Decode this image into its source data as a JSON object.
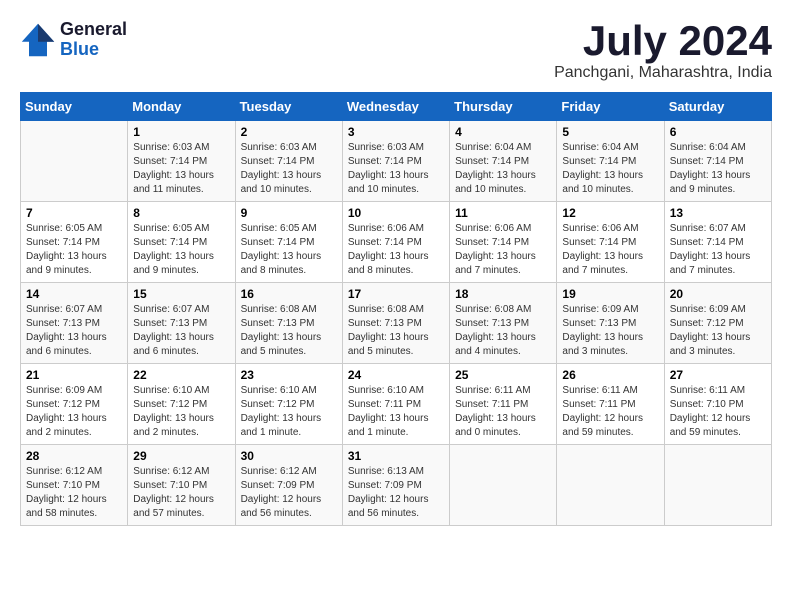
{
  "header": {
    "logo_line1": "General",
    "logo_line2": "Blue",
    "month": "July 2024",
    "location": "Panchgani, Maharashtra, India"
  },
  "columns": [
    "Sunday",
    "Monday",
    "Tuesday",
    "Wednesday",
    "Thursday",
    "Friday",
    "Saturday"
  ],
  "weeks": [
    [
      {
        "day": "",
        "info": ""
      },
      {
        "day": "1",
        "info": "Sunrise: 6:03 AM\nSunset: 7:14 PM\nDaylight: 13 hours\nand 11 minutes."
      },
      {
        "day": "2",
        "info": "Sunrise: 6:03 AM\nSunset: 7:14 PM\nDaylight: 13 hours\nand 10 minutes."
      },
      {
        "day": "3",
        "info": "Sunrise: 6:03 AM\nSunset: 7:14 PM\nDaylight: 13 hours\nand 10 minutes."
      },
      {
        "day": "4",
        "info": "Sunrise: 6:04 AM\nSunset: 7:14 PM\nDaylight: 13 hours\nand 10 minutes."
      },
      {
        "day": "5",
        "info": "Sunrise: 6:04 AM\nSunset: 7:14 PM\nDaylight: 13 hours\nand 10 minutes."
      },
      {
        "day": "6",
        "info": "Sunrise: 6:04 AM\nSunset: 7:14 PM\nDaylight: 13 hours\nand 9 minutes."
      }
    ],
    [
      {
        "day": "7",
        "info": "Sunrise: 6:05 AM\nSunset: 7:14 PM\nDaylight: 13 hours\nand 9 minutes."
      },
      {
        "day": "8",
        "info": "Sunrise: 6:05 AM\nSunset: 7:14 PM\nDaylight: 13 hours\nand 9 minutes."
      },
      {
        "day": "9",
        "info": "Sunrise: 6:05 AM\nSunset: 7:14 PM\nDaylight: 13 hours\nand 8 minutes."
      },
      {
        "day": "10",
        "info": "Sunrise: 6:06 AM\nSunset: 7:14 PM\nDaylight: 13 hours\nand 8 minutes."
      },
      {
        "day": "11",
        "info": "Sunrise: 6:06 AM\nSunset: 7:14 PM\nDaylight: 13 hours\nand 7 minutes."
      },
      {
        "day": "12",
        "info": "Sunrise: 6:06 AM\nSunset: 7:14 PM\nDaylight: 13 hours\nand 7 minutes."
      },
      {
        "day": "13",
        "info": "Sunrise: 6:07 AM\nSunset: 7:14 PM\nDaylight: 13 hours\nand 7 minutes."
      }
    ],
    [
      {
        "day": "14",
        "info": "Sunrise: 6:07 AM\nSunset: 7:13 PM\nDaylight: 13 hours\nand 6 minutes."
      },
      {
        "day": "15",
        "info": "Sunrise: 6:07 AM\nSunset: 7:13 PM\nDaylight: 13 hours\nand 6 minutes."
      },
      {
        "day": "16",
        "info": "Sunrise: 6:08 AM\nSunset: 7:13 PM\nDaylight: 13 hours\nand 5 minutes."
      },
      {
        "day": "17",
        "info": "Sunrise: 6:08 AM\nSunset: 7:13 PM\nDaylight: 13 hours\nand 5 minutes."
      },
      {
        "day": "18",
        "info": "Sunrise: 6:08 AM\nSunset: 7:13 PM\nDaylight: 13 hours\nand 4 minutes."
      },
      {
        "day": "19",
        "info": "Sunrise: 6:09 AM\nSunset: 7:13 PM\nDaylight: 13 hours\nand 3 minutes."
      },
      {
        "day": "20",
        "info": "Sunrise: 6:09 AM\nSunset: 7:12 PM\nDaylight: 13 hours\nand 3 minutes."
      }
    ],
    [
      {
        "day": "21",
        "info": "Sunrise: 6:09 AM\nSunset: 7:12 PM\nDaylight: 13 hours\nand 2 minutes."
      },
      {
        "day": "22",
        "info": "Sunrise: 6:10 AM\nSunset: 7:12 PM\nDaylight: 13 hours\nand 2 minutes."
      },
      {
        "day": "23",
        "info": "Sunrise: 6:10 AM\nSunset: 7:12 PM\nDaylight: 13 hours\nand 1 minute."
      },
      {
        "day": "24",
        "info": "Sunrise: 6:10 AM\nSunset: 7:11 PM\nDaylight: 13 hours\nand 1 minute."
      },
      {
        "day": "25",
        "info": "Sunrise: 6:11 AM\nSunset: 7:11 PM\nDaylight: 13 hours\nand 0 minutes."
      },
      {
        "day": "26",
        "info": "Sunrise: 6:11 AM\nSunset: 7:11 PM\nDaylight: 12 hours\nand 59 minutes."
      },
      {
        "day": "27",
        "info": "Sunrise: 6:11 AM\nSunset: 7:10 PM\nDaylight: 12 hours\nand 59 minutes."
      }
    ],
    [
      {
        "day": "28",
        "info": "Sunrise: 6:12 AM\nSunset: 7:10 PM\nDaylight: 12 hours\nand 58 minutes."
      },
      {
        "day": "29",
        "info": "Sunrise: 6:12 AM\nSunset: 7:10 PM\nDaylight: 12 hours\nand 57 minutes."
      },
      {
        "day": "30",
        "info": "Sunrise: 6:12 AM\nSunset: 7:09 PM\nDaylight: 12 hours\nand 56 minutes."
      },
      {
        "day": "31",
        "info": "Sunrise: 6:13 AM\nSunset: 7:09 PM\nDaylight: 12 hours\nand 56 minutes."
      },
      {
        "day": "",
        "info": ""
      },
      {
        "day": "",
        "info": ""
      },
      {
        "day": "",
        "info": ""
      }
    ]
  ]
}
